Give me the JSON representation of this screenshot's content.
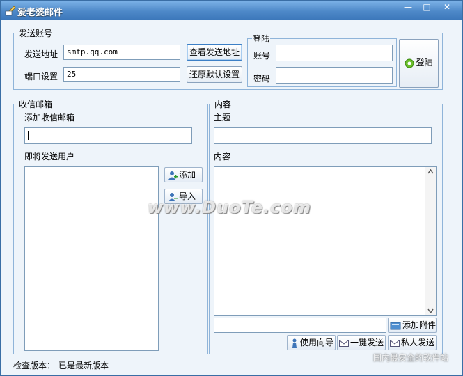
{
  "window": {
    "title": "爱老婆邮件",
    "controls": {
      "minimize": "—",
      "maximize": "□",
      "close": "✕"
    }
  },
  "send_account": {
    "legend": "发送账号",
    "address_label": "发送地址",
    "address_value": "smtp.qq.com",
    "port_label": "端口设置",
    "port_value": "25",
    "view_address_button": "查看发送地址",
    "restore_default_button": "还原默认设置"
  },
  "login": {
    "legend": "登陆",
    "account_label": "账号",
    "account_value": "",
    "password_label": "密码",
    "password_value": "",
    "login_button": "登陆"
  },
  "inbox": {
    "legend": "收信邮箱",
    "add_label": "添加收信邮箱",
    "add_value": "",
    "pending_label": "即将发送用户",
    "add_button": "添加",
    "import_button": "导入"
  },
  "content": {
    "legend": "内容",
    "subject_label": "主题",
    "subject_value": "",
    "body_label": "内容",
    "body_value": "",
    "attachment_value": "",
    "attach_button": "添加附件",
    "wizard_button": "使用向导",
    "one_click_button": "一键发送",
    "private_button": "私人发送"
  },
  "status": {
    "label": "检查版本：",
    "value": "已是最新版本"
  },
  "watermarks": {
    "center": "www.DuoTe.com",
    "corner": "国内最安全的软件站"
  },
  "colors": {
    "titlebar": "#4d88c8",
    "border": "#8fb4d9",
    "login_icon": "#6cbf2c"
  },
  "icons": {
    "app": "envelope-pen-icon",
    "login": "green-circle-icon",
    "user": "user-icon",
    "attach": "attachment-icon",
    "wizard": "person-icon",
    "mail": "envelope-icon"
  }
}
